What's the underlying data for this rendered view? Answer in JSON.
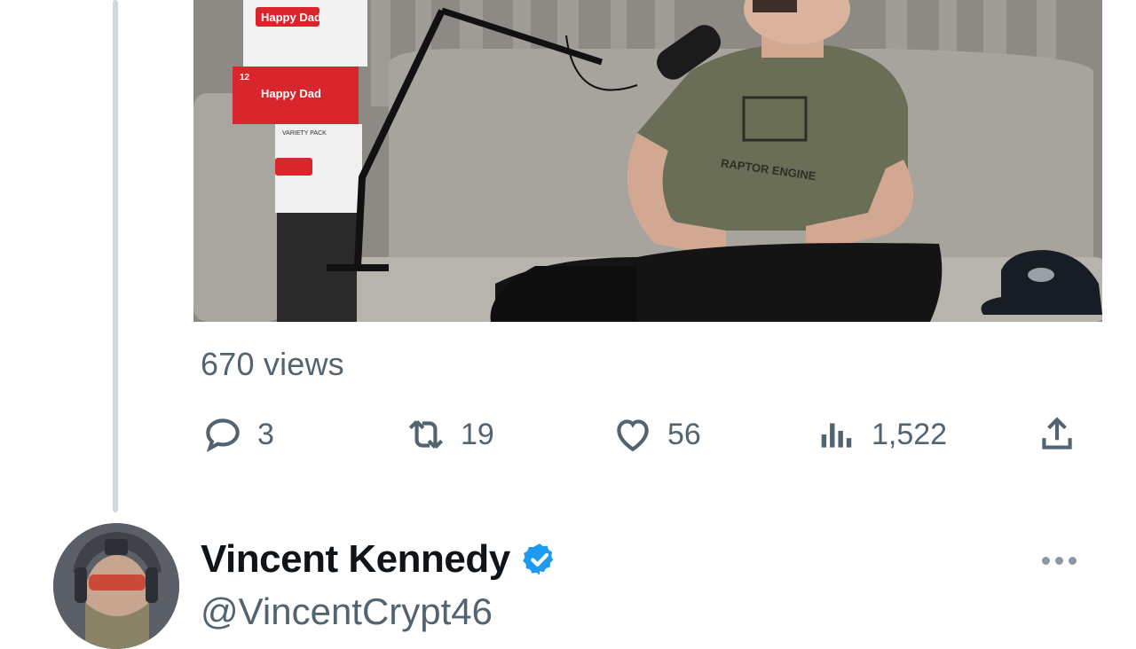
{
  "tweet": {
    "media": {
      "type": "video-thumbnail",
      "box_brand_text": "Happy Dad",
      "box_small_text": "VARIETY PACK",
      "box_count_text": "12",
      "shirt_text": "RAPTOR ENGINE"
    },
    "views_label": "670 views",
    "actions": {
      "reply": {
        "icon": "reply-icon",
        "count": "3"
      },
      "retweet": {
        "icon": "retweet-icon",
        "count": "19"
      },
      "like": {
        "icon": "heart-icon",
        "count": "56"
      },
      "views": {
        "icon": "analytics-icon",
        "count": "1,522"
      },
      "share": {
        "icon": "share-icon"
      }
    }
  },
  "reply_author": {
    "display_name": "Vincent Kennedy",
    "handle": "@VincentCrypt46",
    "verified": true,
    "verified_color": "#1d9bf0"
  },
  "colors": {
    "text_primary": "#0f1419",
    "text_secondary": "#536471",
    "thread_line": "#cfd9de"
  }
}
